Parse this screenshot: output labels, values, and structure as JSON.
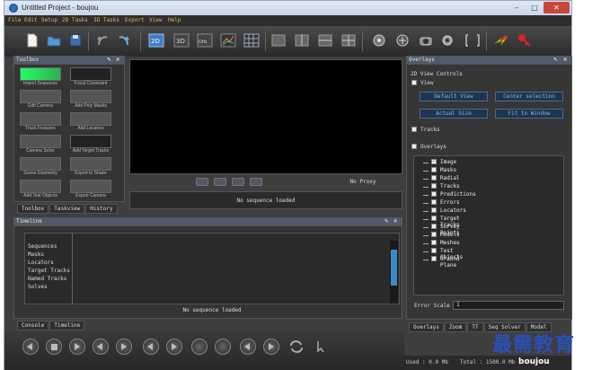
{
  "window": {
    "title": "Untitled Project - boujou",
    "min": "–",
    "max": "□",
    "close": "✕"
  },
  "menu": [
    "File",
    "Edit",
    "Setup",
    "2D Tasks",
    "3D Tasks",
    "Export",
    "View",
    "Help"
  ],
  "toolbox": {
    "title": "Toolbox",
    "tools": [
      "Import Sequence",
      "Focal Constraint",
      "Edit Camera",
      "Add Poly Masks",
      "Track Features",
      "Add Locators",
      "Camera Solve",
      "Add Target Tracks",
      "Scene Geometry",
      "Export to Shake",
      "Add Test Objects",
      "Export Camera"
    ],
    "tabs": [
      "Toolbox",
      "Taskview",
      "History"
    ]
  },
  "viewer": {
    "status": "No sequence loaded",
    "proxy": "No Proxy"
  },
  "overlays": {
    "title": "Overlays",
    "view_controls": "2D View Controls",
    "view_label": "View",
    "buttons": [
      "Default View",
      "Center selection",
      "Actual Size",
      "Fit to Window"
    ],
    "tracks_label": "Tracks",
    "overlays_label": "Overlays",
    "tree": [
      "Image",
      "Masks",
      "Radial",
      "Tracks",
      "Predictions",
      "Errors",
      "Locators",
      "Target Tracks",
      "Survey Points",
      "Models",
      "Meshes",
      "Test Objects",
      "Ground Plane"
    ],
    "error_scale_label": "Error Scale",
    "error_scale_value": "1",
    "tabs": [
      "Overlays",
      "Zoom",
      "TT",
      "Seq Solver",
      "Model"
    ]
  },
  "timeline": {
    "title": "Timeline",
    "rows": [
      "Sequences",
      "Masks",
      "Locators",
      "Target Tracks",
      "Named Tracks",
      "Solves"
    ],
    "status": "No sequence loaded",
    "tabs": [
      "Console",
      "Timeline"
    ]
  },
  "status": {
    "used": "Used : 0.0 Mb",
    "total": "Total : 1500.0 Mb",
    "logo": "boujou"
  },
  "watermark": "最需教育",
  "colors": {
    "accent": "#4f5b68",
    "menu_text": "#e8b050",
    "button_text": "#8fb5de",
    "watermark": "#2b4fb8"
  }
}
